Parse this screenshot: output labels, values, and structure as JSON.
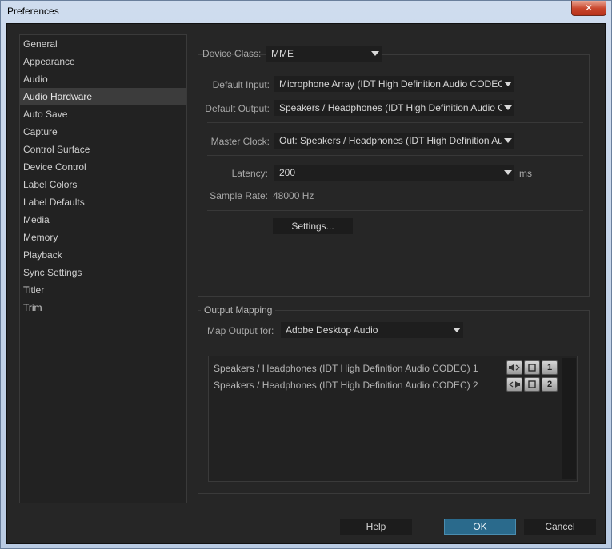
{
  "window": {
    "title": "Preferences",
    "close_label": "✕"
  },
  "sidebar": {
    "items": [
      {
        "label": "General"
      },
      {
        "label": "Appearance"
      },
      {
        "label": "Audio"
      },
      {
        "label": "Audio Hardware",
        "selected": true
      },
      {
        "label": "Auto Save"
      },
      {
        "label": "Capture"
      },
      {
        "label": "Control Surface"
      },
      {
        "label": "Device Control"
      },
      {
        "label": "Label Colors"
      },
      {
        "label": "Label Defaults"
      },
      {
        "label": "Media"
      },
      {
        "label": "Memory"
      },
      {
        "label": "Playback"
      },
      {
        "label": "Sync Settings"
      },
      {
        "label": "Titler"
      },
      {
        "label": "Trim"
      }
    ]
  },
  "device": {
    "class_label": "Device Class:",
    "class_value": "MME",
    "input_label": "Default Input:",
    "input_value": "Microphone Array (IDT High Definition Audio CODEC)",
    "output_label": "Default Output:",
    "output_value": "Speakers / Headphones (IDT High Definition Audio CODEC)",
    "clock_label": "Master Clock:",
    "clock_value": "Out: Speakers / Headphones (IDT High Definition Audio CODEC)",
    "latency_label": "Latency:",
    "latency_value": "200",
    "latency_unit": "ms",
    "rate_label": "Sample Rate:",
    "rate_value": "48000 Hz",
    "settings_button": "Settings..."
  },
  "output_mapping": {
    "legend": "Output Mapping",
    "map_for_label": "Map Output for:",
    "map_for_value": "Adobe Desktop Audio",
    "rows": [
      {
        "label": "Speakers / Headphones (IDT High Definition Audio CODEC) 1",
        "channel": "1"
      },
      {
        "label": "Speakers / Headphones (IDT High Definition Audio CODEC) 2",
        "channel": "2"
      }
    ]
  },
  "footer": {
    "help": "Help",
    "ok": "OK",
    "cancel": "Cancel"
  },
  "colors": {
    "ok_accent": "#2a6a8c",
    "panel_bg": "#262626"
  }
}
